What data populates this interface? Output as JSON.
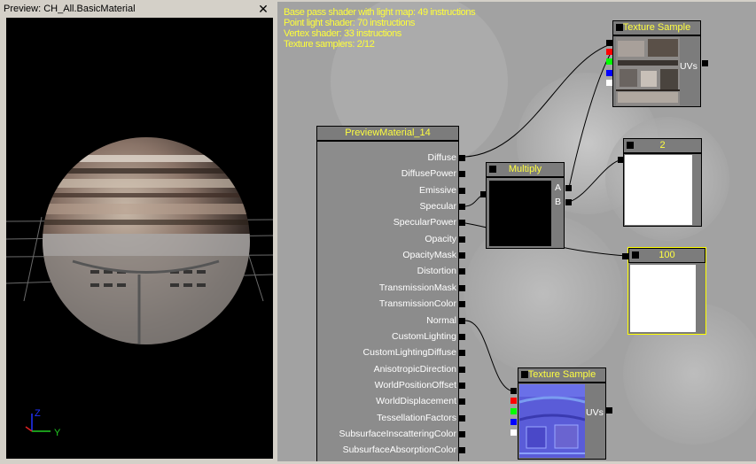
{
  "preview": {
    "title": "Preview: CH_All.BasicMaterial",
    "close": "✕",
    "axes": {
      "z": "Z",
      "y": "Y"
    }
  },
  "stats": [
    "Base pass shader with light map: 49 instructions",
    "Point light shader: 70 instructions",
    "Vertex shader: 33 instructions",
    "Texture samplers: 2/12"
  ],
  "material_node": {
    "title": "PreviewMaterial_14",
    "inputs": [
      "Diffuse",
      "DiffusePower",
      "Emissive",
      "Specular",
      "SpecularPower",
      "Opacity",
      "OpacityMask",
      "Distortion",
      "TransmissionMask",
      "TransmissionColor",
      "Normal",
      "CustomLighting",
      "CustomLightingDiffuse",
      "AnisotropicDirection",
      "WorldPositionOffset",
      "WorldDisplacement",
      "TessellationFactors",
      "SubsurfaceInscatteringColor",
      "SubsurfaceAbsorptionColor"
    ]
  },
  "texture_sample_top": {
    "title": "Texture Sample",
    "output": "UVs"
  },
  "texture_sample_bottom": {
    "title": "Texture Sample",
    "output": "UVs"
  },
  "multiply": {
    "title": "Multiply",
    "inputs": [
      "A",
      "B"
    ]
  },
  "const_2": {
    "title": "2"
  },
  "const_100": {
    "title": "100"
  },
  "colors": {
    "stats_text": "#ffff38",
    "node_title_text": "#ffff40",
    "selected_border": "#ffff00",
    "pin_red": "#ff0000",
    "pin_green": "#00ff00",
    "pin_blue": "#0000ff",
    "pin_white": "#ffffff"
  }
}
